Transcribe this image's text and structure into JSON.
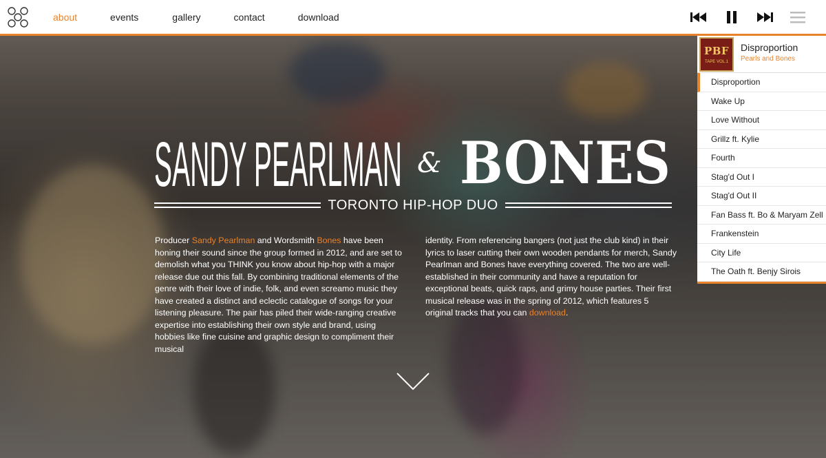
{
  "nav": {
    "items": [
      {
        "label": "about",
        "active": true
      },
      {
        "label": "events",
        "active": false
      },
      {
        "label": "gallery",
        "active": false
      },
      {
        "label": "contact",
        "active": false
      },
      {
        "label": "download",
        "active": false
      }
    ]
  },
  "controls": [
    "previous-track-icon",
    "pause-icon",
    "next-track-icon",
    "menu-icon"
  ],
  "hero": {
    "title_left": "SANDY PEARLMAN",
    "title_amp": "&",
    "title_right": "BONES",
    "subtitle": "TORONTO HIP-HOP DUO"
  },
  "about": {
    "p1_a": "Producer ",
    "p1_link1": "Sandy Pearlman",
    "p1_b": " and Wordsmith ",
    "p1_link2": "Bones",
    "p1_c": " have been honing their sound since the group formed in 2012, and are set to demolish what you THINK you know about hip-hop with a major release due out this fall. By combining traditional elements of the genre with their love of indie, folk, and even screamo music they have created a distinct and eclectic catalogue of songs for your listening pleasure. The pair has piled their wide-ranging creative expertise into establishing their own style and brand, using hobbies like fine cuisine and graphic design to compliment their musical",
    "p2_a": "identity. From referencing bangers (not just the club kind) in their lyrics to laser cutting their own wooden pendants for merch, Sandy Pearlman and Bones have everything covered. The two are well-established in their community and have a reputation for exceptional beats, quick raps, and grimy house parties. Their first musical release was in the spring of 2012, which features 5 original tracks that you can ",
    "p2_link": "download",
    "p2_b": "."
  },
  "player": {
    "cover_text": "PBF",
    "cover_sub": "TAPE VOL.1",
    "now_playing_title": "Disproportion",
    "now_playing_artist": "Pearls and Bones",
    "tracks": [
      "Disproportion",
      "Wake Up",
      "Love Without",
      "Grillz ft. Kylie",
      "Fourth",
      "Stag'd Out I",
      "Stag'd Out II",
      "Fan Bass ft. Bo & Maryam Zell",
      "Frankenstein",
      "City Life",
      "The Oath ft. Benjy Sirois"
    ],
    "current_index": 0
  },
  "colors": {
    "accent": "#e8832a",
    "bar": "#ffffff",
    "text": "#222222"
  }
}
